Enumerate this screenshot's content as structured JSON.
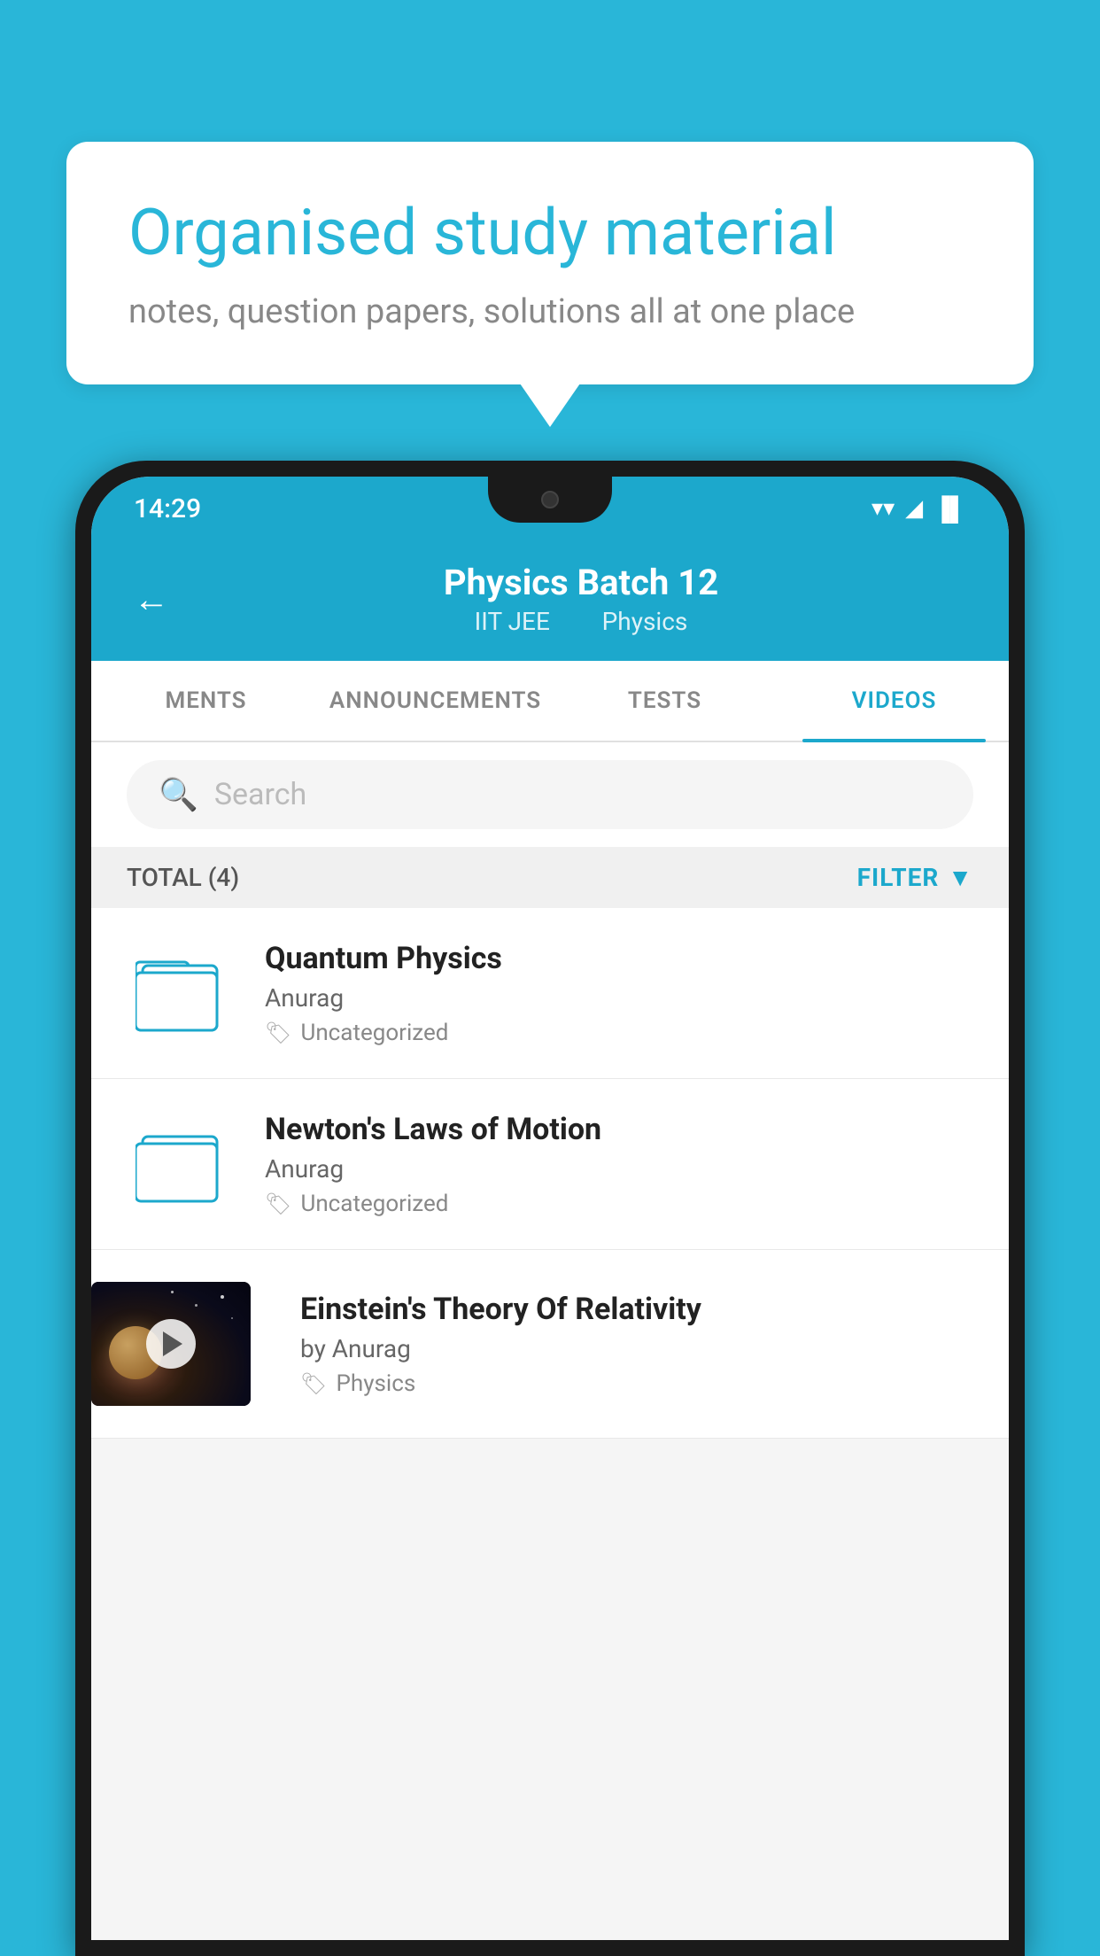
{
  "background_color": "#29b6d8",
  "speech_bubble": {
    "title": "Organised study material",
    "subtitle": "notes, question papers, solutions all at one place"
  },
  "status_bar": {
    "time": "14:29",
    "wifi": "▼",
    "signal": "◀",
    "battery": "▐"
  },
  "app_header": {
    "back_label": "←",
    "title": "Physics Batch 12",
    "subtitle_part1": "IIT JEE",
    "subtitle_part2": "Physics"
  },
  "tabs": [
    {
      "label": "MENTS",
      "active": false
    },
    {
      "label": "ANNOUNCEMENTS",
      "active": false
    },
    {
      "label": "TESTS",
      "active": false
    },
    {
      "label": "VIDEOS",
      "active": true
    }
  ],
  "search": {
    "placeholder": "Search"
  },
  "filter_bar": {
    "total_label": "TOTAL (4)",
    "filter_label": "FILTER"
  },
  "videos": [
    {
      "title": "Quantum Physics",
      "author": "Anurag",
      "tag": "Uncategorized",
      "has_thumbnail": false
    },
    {
      "title": "Newton's Laws of Motion",
      "author": "Anurag",
      "tag": "Uncategorized",
      "has_thumbnail": false
    },
    {
      "title": "Einstein's Theory Of Relativity",
      "author": "by Anurag",
      "tag": "Physics",
      "has_thumbnail": true
    }
  ]
}
